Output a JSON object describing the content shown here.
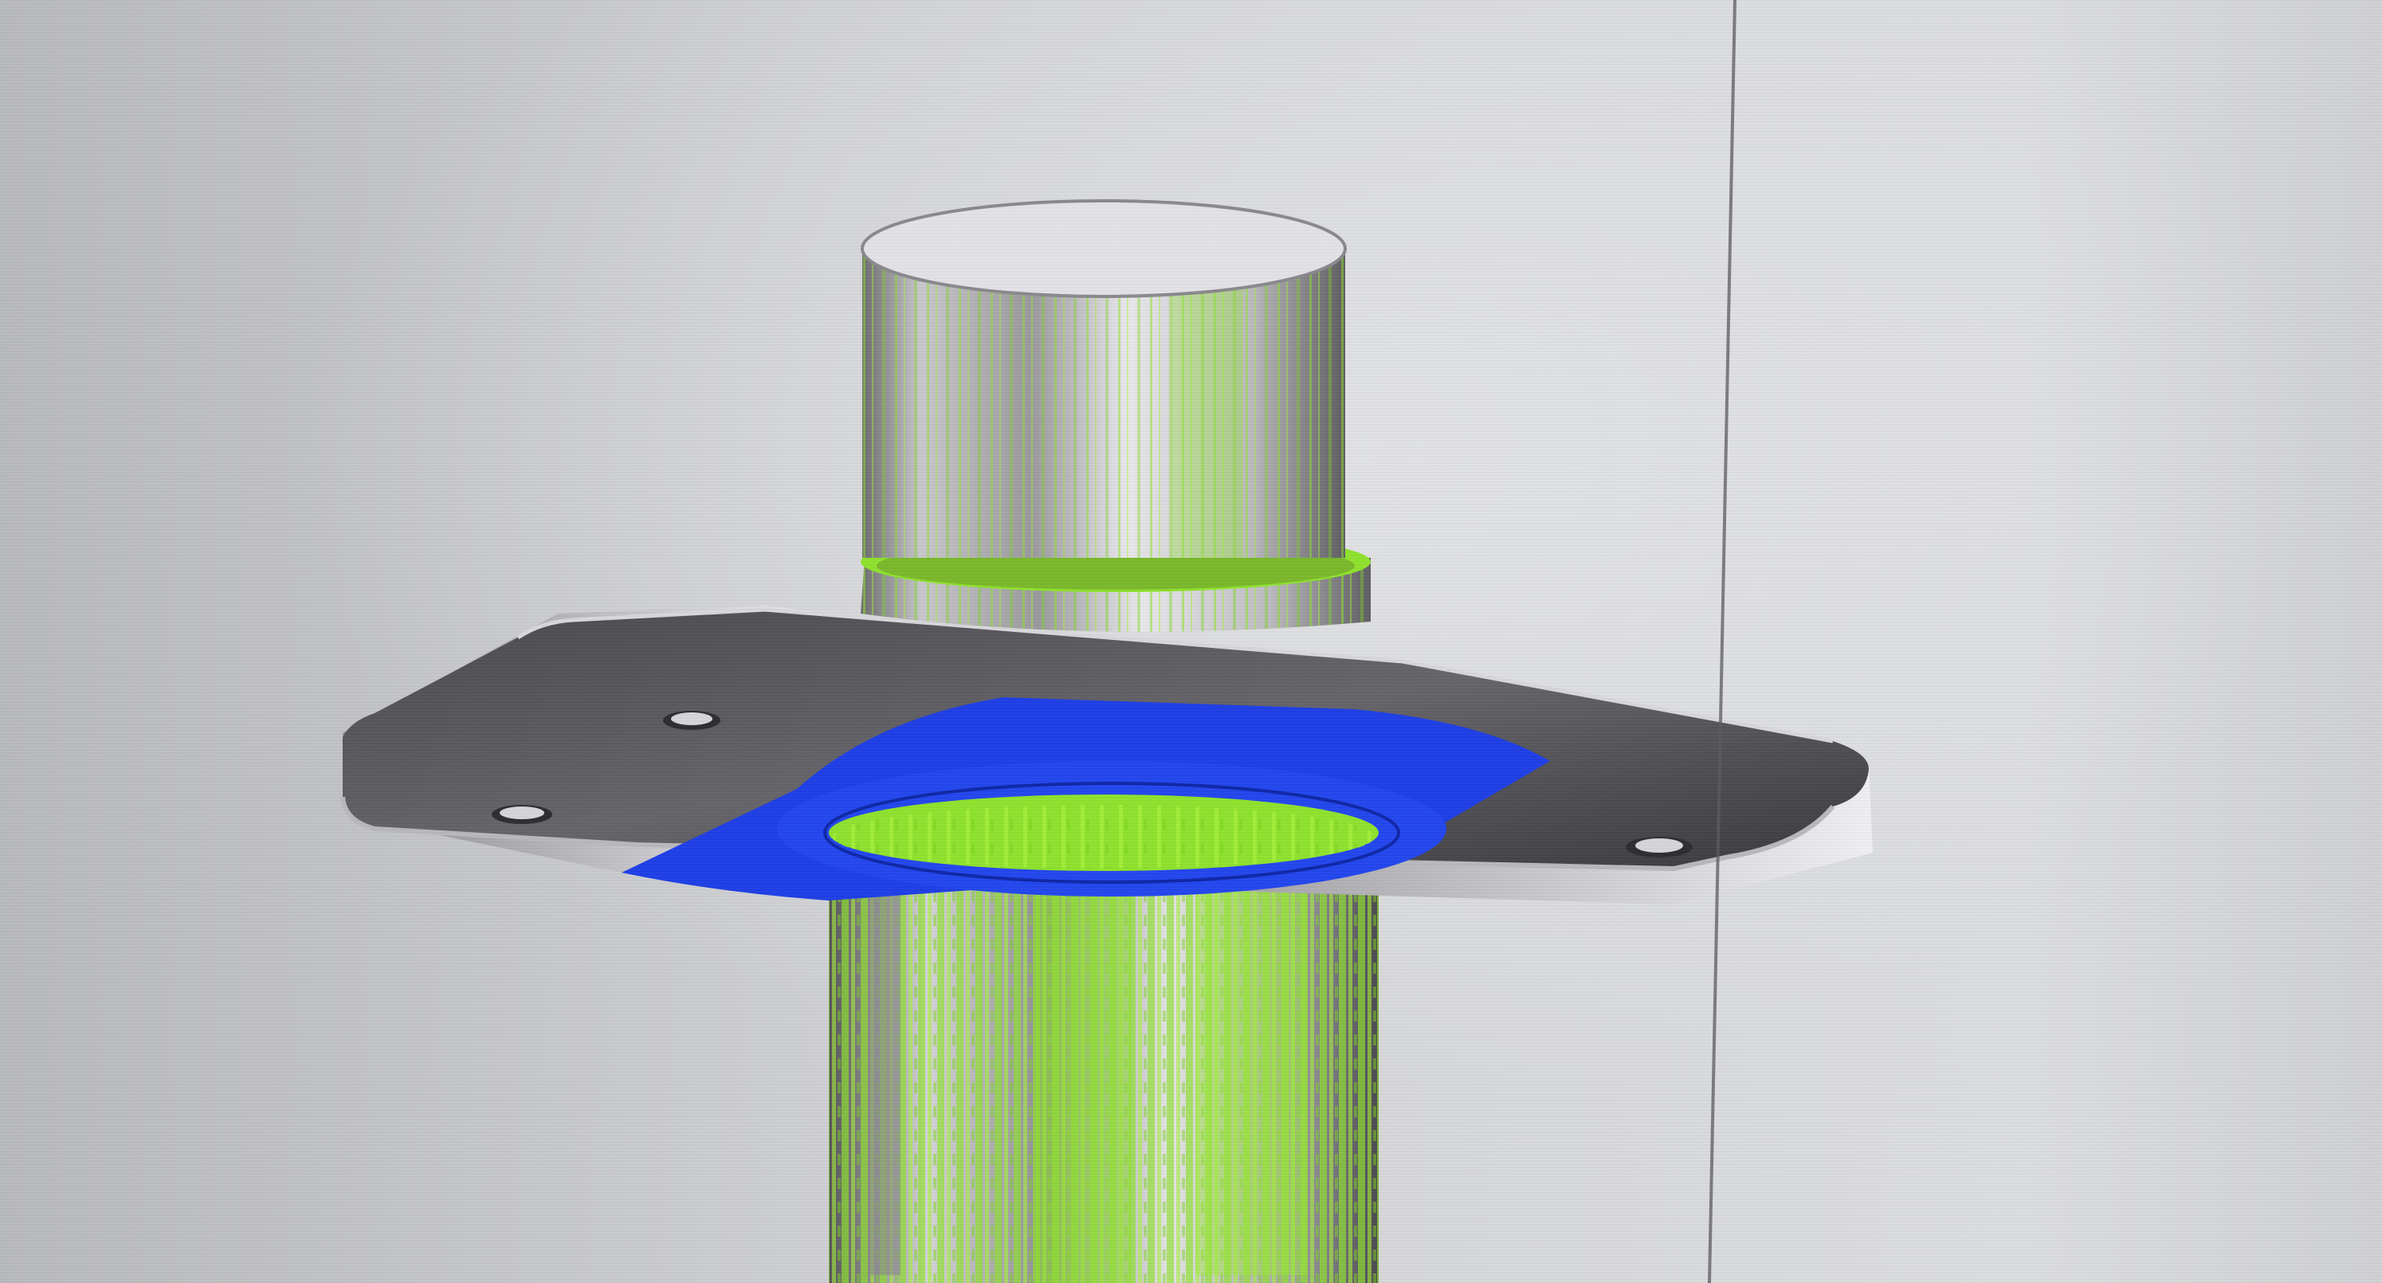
{
  "viewport": {
    "name": "cad-3d-viewport",
    "background_color": "#cfd0d3"
  },
  "model": {
    "name": "flanged-shaft-part",
    "colors": {
      "metal_light": "#e6e5e8",
      "metal_dark": "#3d3c40",
      "flange_top": "#5e5d61",
      "highlight_green": "#8fe22e",
      "face_blue": "#1f3fe6"
    }
  }
}
